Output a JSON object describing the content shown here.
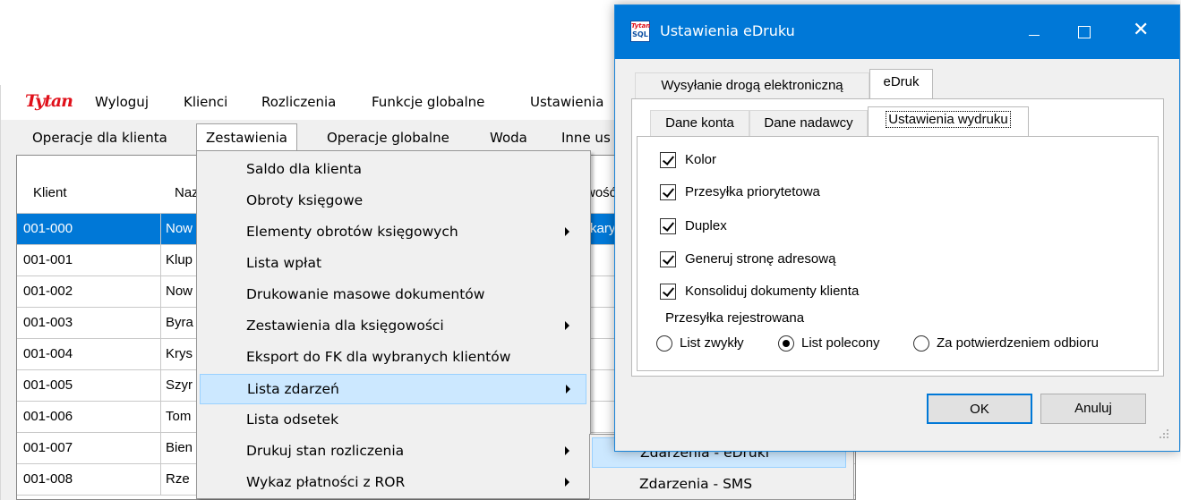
{
  "app": {
    "logo": "Tytan",
    "menubar": [
      "Wyloguj",
      "Klienci",
      "Rozliczenia",
      "Funkcje globalne",
      "Ustawienia"
    ],
    "toolbar": [
      "Operacje dla klienta",
      "Zestawienia",
      "Operacje globalne",
      "Woda",
      "Inne us"
    ],
    "toolbar_active": "Zestawienia"
  },
  "grid": {
    "columns": [
      "Klient",
      "Naz",
      "wość"
    ],
    "rows": [
      {
        "klient": "001-000",
        "nazwa": "Now",
        "selected": true,
        "extra": "kary"
      },
      {
        "klient": "001-001",
        "nazwa": "Klup"
      },
      {
        "klient": "001-002",
        "nazwa": "Now"
      },
      {
        "klient": "001-003",
        "nazwa": "Byra"
      },
      {
        "klient": "001-004",
        "nazwa": "Krys"
      },
      {
        "klient": "001-005",
        "nazwa": "Szyr"
      },
      {
        "klient": "001-006",
        "nazwa": "Tom"
      },
      {
        "klient": "001-007",
        "nazwa": "Bien"
      },
      {
        "klient": "001-008",
        "nazwa": "Rze"
      }
    ]
  },
  "menu": {
    "items": [
      {
        "label": "Saldo dla klienta",
        "submenu": false
      },
      {
        "label": "Obroty księgowe",
        "submenu": false
      },
      {
        "label": "Elementy obrotów księgowych",
        "submenu": true
      },
      {
        "label": "Lista wpłat",
        "submenu": false
      },
      {
        "label": "Drukowanie masowe dokumentów",
        "submenu": false
      },
      {
        "label": "Zestawienia dla księgowości",
        "submenu": true
      },
      {
        "label": "Eksport do FK dla wybranych klientów",
        "submenu": false
      },
      {
        "label": "Lista zdarzeń",
        "submenu": true,
        "highlighted": true
      },
      {
        "label": "Lista odsetek",
        "submenu": false
      },
      {
        "label": "Drukuj stan rozliczenia",
        "submenu": true
      },
      {
        "label": "Wykaz płatności z ROR",
        "submenu": true
      }
    ],
    "submenu_items": [
      {
        "label": "Zdarzenia - eDruki",
        "highlighted": true
      },
      {
        "label": "Zdarzenia - SMS"
      }
    ]
  },
  "dialog": {
    "icon_text_top": "Tytan",
    "icon_text_bottom": "SQL",
    "title": "Ustawienia eDruku",
    "outer_tabs": [
      "Wysyłanie drogą elektroniczną",
      "eDruk"
    ],
    "inner_tabs": [
      "Dane konta",
      "Dane nadawcy",
      "Ustawienia wydruku"
    ],
    "checkboxes": [
      {
        "label": "Kolor",
        "checked": true
      },
      {
        "label": "Przesyłka priorytetowa",
        "checked": true
      },
      {
        "label": "Duplex",
        "checked": true
      },
      {
        "label": "Generuj stronę adresową",
        "checked": true
      },
      {
        "label": "Konsoliduj dokumenty klienta",
        "checked": true
      }
    ],
    "radio_group_label": "Przesyłka rejestrowana",
    "radios": [
      {
        "label": "List zwykły",
        "checked": false
      },
      {
        "label": "List polecony",
        "checked": true
      },
      {
        "label": "Za potwierdzeniem odbioru",
        "checked": false
      }
    ],
    "ok_label": "OK",
    "cancel_label": "Anuluj"
  },
  "colors": {
    "accent": "#0078d7",
    "selection": "#cce8ff",
    "logo": "#e0101a"
  }
}
